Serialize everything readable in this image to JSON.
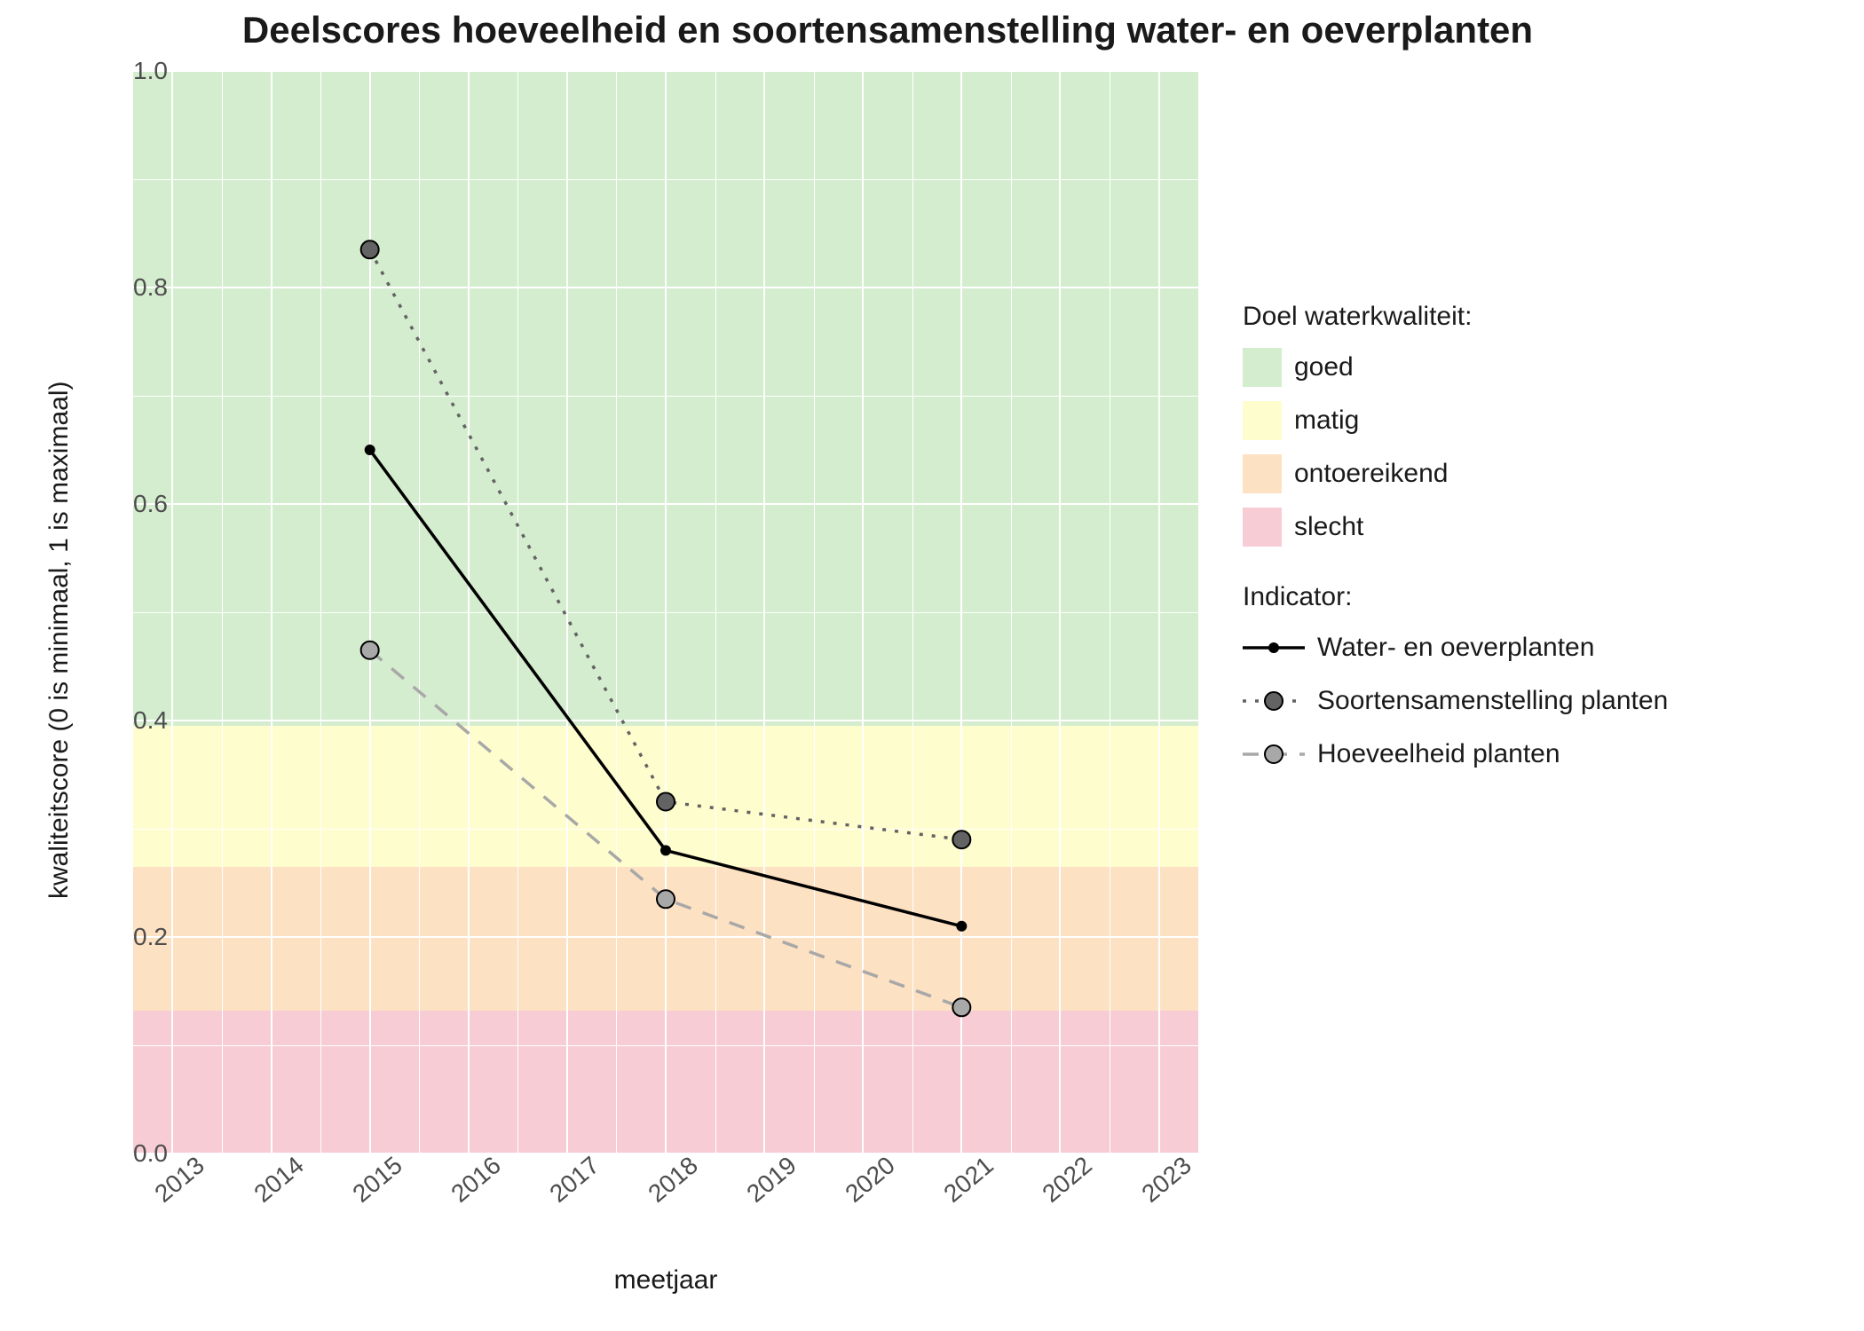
{
  "chart_data": {
    "type": "line",
    "title": "Deelscores hoeveelheid en soortensamenstelling water- en oeverplanten",
    "xlabel": "meetjaar",
    "ylabel": "kwaliteitscore (0 is minimaal, 1 is maximaal)",
    "x": [
      2015,
      2018,
      2021
    ],
    "x_ticks": [
      2013,
      2014,
      2015,
      2016,
      2017,
      2018,
      2019,
      2020,
      2021,
      2022,
      2023
    ],
    "y_ticks": [
      0.0,
      0.2,
      0.4,
      0.6,
      0.8,
      1.0
    ],
    "y_tick_labels": [
      "0.0",
      "0.2",
      "0.4",
      "0.6",
      "0.8",
      "1.0"
    ],
    "xlim": [
      2012.6,
      2023.4
    ],
    "ylim": [
      0.0,
      1.0
    ],
    "series": [
      {
        "name": "Water- en oeverplanten",
        "values": [
          0.65,
          0.28,
          0.21
        ],
        "color": "#000000",
        "dash": "solid",
        "point_r": 6
      },
      {
        "name": "Soortensamenstelling planten",
        "values": [
          0.835,
          0.325,
          0.29
        ],
        "color": "#636363",
        "dash": "dotted",
        "point_r": 10
      },
      {
        "name": "Hoeveelheid planten",
        "values": [
          0.465,
          0.235,
          0.135
        ],
        "color": "#A8A8A8",
        "dash": "dashed",
        "point_r": 10
      }
    ],
    "bands": [
      {
        "name": "goed",
        "from": 0.395,
        "to": 1.0,
        "color": "#D5EDCF"
      },
      {
        "name": "matig",
        "from": 0.265,
        "to": 0.395,
        "color": "#FEFDCE"
      },
      {
        "name": "ontoereikend",
        "from": 0.132,
        "to": 0.265,
        "color": "#FDE1C3"
      },
      {
        "name": "slecht",
        "from": 0.0,
        "to": 0.132,
        "color": "#F8CCD5"
      }
    ],
    "legend_bands_title": "Doel waterkwaliteit:",
    "legend_series_title": "Indicator:"
  }
}
